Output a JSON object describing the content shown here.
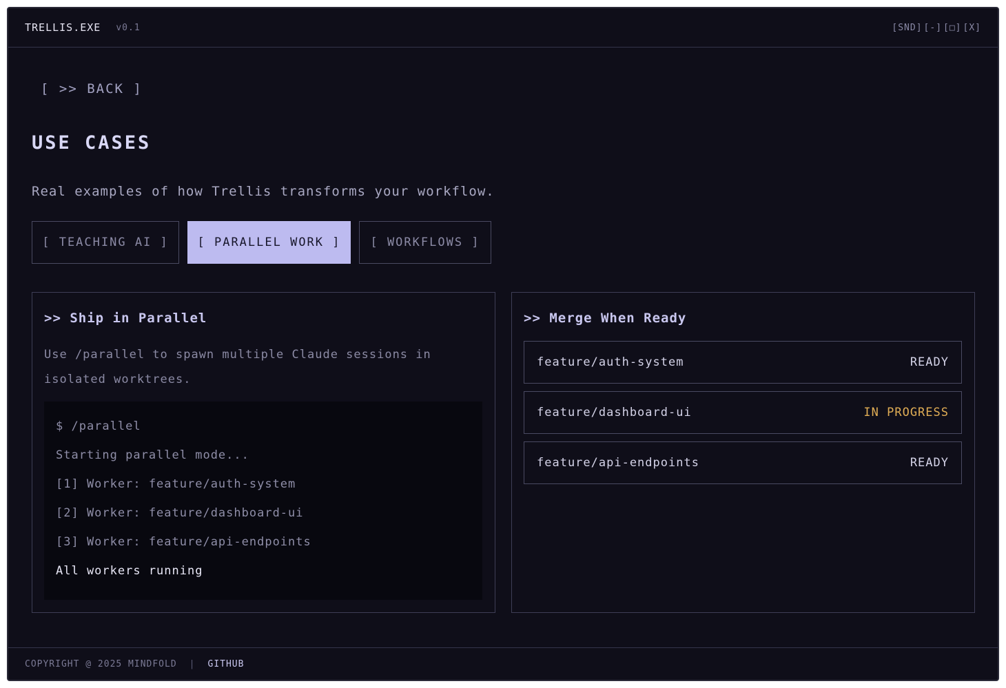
{
  "titlebar": {
    "app_title": "TRELLIS.EXE",
    "version": "v0.1",
    "controls": [
      "[SND]",
      "[-]",
      "[□]",
      "[X]"
    ]
  },
  "nav": {
    "back_label": "[ >> BACK ]"
  },
  "page": {
    "title": "USE CASES",
    "subtitle": "Real examples of how Trellis transforms your workflow."
  },
  "tabs": [
    {
      "label": "[ TEACHING AI ]",
      "active": false
    },
    {
      "label": "[ PARALLEL WORK ]",
      "active": true
    },
    {
      "label": "[ WORKFLOWS ]",
      "active": false
    }
  ],
  "left_panel": {
    "heading": ">> Ship in Parallel",
    "description": "Use /parallel to spawn multiple Claude sessions in isolated worktrees.",
    "terminal_lines": [
      "$ /parallel",
      "Starting parallel mode...",
      "[1] Worker: feature/auth-system",
      "[2] Worker: feature/dashboard-ui",
      "[3] Worker: feature/api-endpoints",
      "All workers running"
    ]
  },
  "right_panel": {
    "heading": ">> Merge When Ready",
    "branches": [
      {
        "name": "feature/auth-system",
        "status": "READY"
      },
      {
        "name": "feature/dashboard-ui",
        "status": "IN PROGRESS"
      },
      {
        "name": "feature/api-endpoints",
        "status": "READY"
      }
    ]
  },
  "footer": {
    "copyright": "COPYRIGHT @ 2025 MINDFOLD",
    "separator": "|",
    "link": "GITHUB"
  },
  "colors": {
    "background": "#0f0e19",
    "accent": "#bdbbf0",
    "in_progress": "#e0ad55",
    "terminal_bg": "#08080f"
  }
}
